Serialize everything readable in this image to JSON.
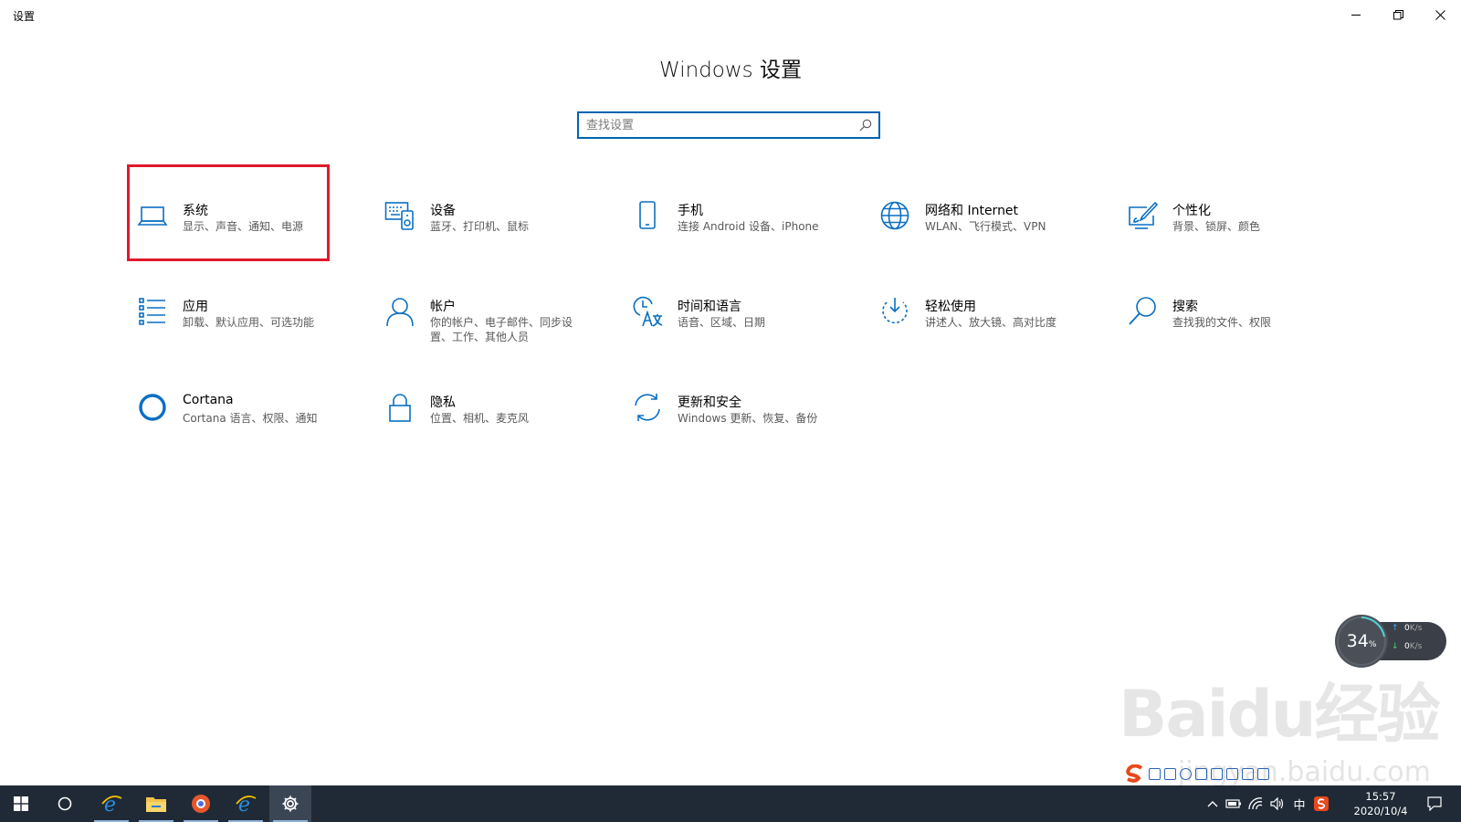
{
  "window": {
    "title": "设置"
  },
  "header": {
    "title": "Windows 设置"
  },
  "search": {
    "placeholder": "查找设置",
    "value": ""
  },
  "tiles": [
    {
      "name": "系统",
      "desc": "显示、声音、通知、电源",
      "icon": "laptop-icon"
    },
    {
      "name": "设备",
      "desc": "蓝牙、打印机、鼠标",
      "icon": "keyboard-devices-icon"
    },
    {
      "name": "手机",
      "desc": "连接 Android 设备、iPhone",
      "icon": "phone-icon"
    },
    {
      "name": "网络和 Internet",
      "desc": "WLAN、飞行模式、VPN",
      "icon": "globe-icon"
    },
    {
      "name": "个性化",
      "desc": "背景、锁屏、颜色",
      "icon": "paintbrush-icon"
    },
    {
      "name": "应用",
      "desc": "卸载、默认应用、可选功能",
      "icon": "apps-list-icon"
    },
    {
      "name": "帐户",
      "desc": "你的帐户、电子邮件、同步设置、工作、其他人员",
      "icon": "person-icon"
    },
    {
      "name": "时间和语言",
      "desc": "语音、区域、日期",
      "icon": "time-language-icon"
    },
    {
      "name": "轻松使用",
      "desc": "讲述人、放大镜、高对比度",
      "icon": "ease-of-access-icon"
    },
    {
      "name": "搜索",
      "desc": "查找我的文件、权限",
      "icon": "search-icon"
    },
    {
      "name": "Cortana",
      "desc": "Cortana 语言、权限、通知",
      "icon": "cortana-ring-icon"
    },
    {
      "name": "隐私",
      "desc": "位置、相机、麦克风",
      "icon": "lock-icon"
    },
    {
      "name": "更新和安全",
      "desc": "Windows 更新、恢复、备份",
      "icon": "sync-icon"
    }
  ],
  "widget": {
    "percent": "34",
    "percent_unit": "%",
    "upload": "0",
    "download": "0",
    "rate_unit": "K/s"
  },
  "watermark": {
    "logo": "Baidu经验",
    "url": "jingyan.baidu.com"
  },
  "taskbar": {
    "ime_label": "中",
    "time": "15:57",
    "date": "2020/10/4"
  },
  "colors": {
    "accent": "#0063b1",
    "icon": "#0a6fc2",
    "highlight": "#e0192c",
    "taskbar": "#1f2a36"
  }
}
